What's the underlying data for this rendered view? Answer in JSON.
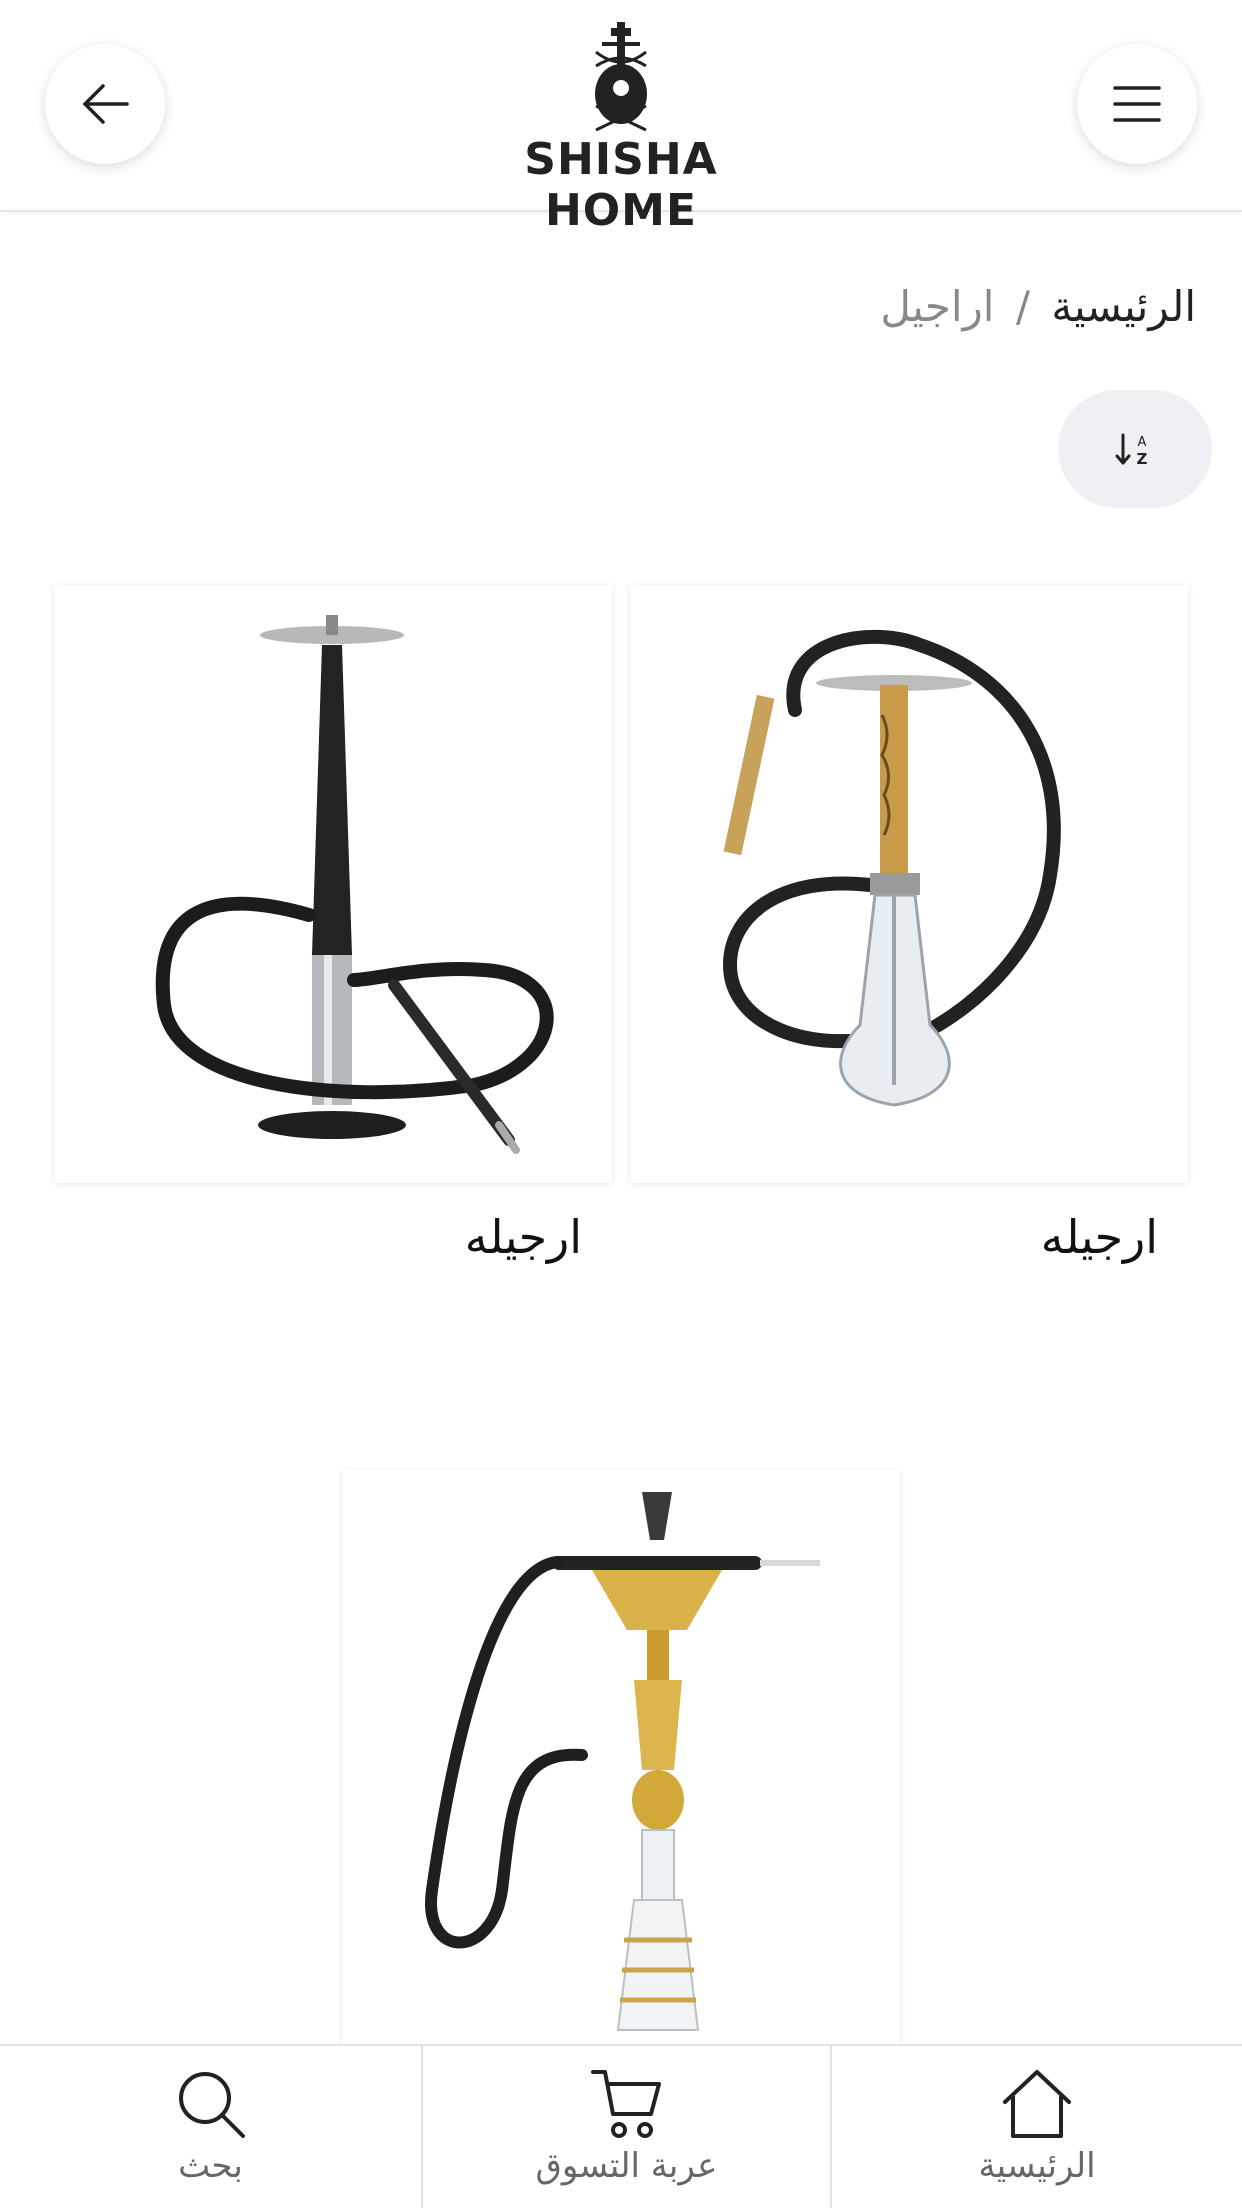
{
  "header": {
    "logo_text": "SHISHA HOME",
    "back_icon": "arrow-left-icon",
    "menu_icon": "hamburger-menu-icon"
  },
  "breadcrumb": {
    "home": "الرئيسية",
    "separator": "/",
    "current": "اراجيل"
  },
  "sort": {
    "icon": "sort-alpha-icon",
    "glyph_top": "A",
    "glyph_bottom": "Z"
  },
  "products": [
    {
      "name": "ارجيله",
      "image": "black-modern-hookah-with-wooden-stem"
    },
    {
      "name": "ارجيله",
      "image": "black-minimal-hookah-with-steel-base"
    },
    {
      "image": "gold-traditional-hookah"
    }
  ],
  "bottom_nav": [
    {
      "label": "بحث",
      "icon": "search-icon"
    },
    {
      "label": "عربة التسوق",
      "icon": "cart-icon"
    },
    {
      "label": "الرئيسية",
      "icon": "home-icon"
    }
  ],
  "colors": {
    "accent_text": "#222222",
    "muted_text": "#888888",
    "sort_bg": "#eef0f3"
  }
}
